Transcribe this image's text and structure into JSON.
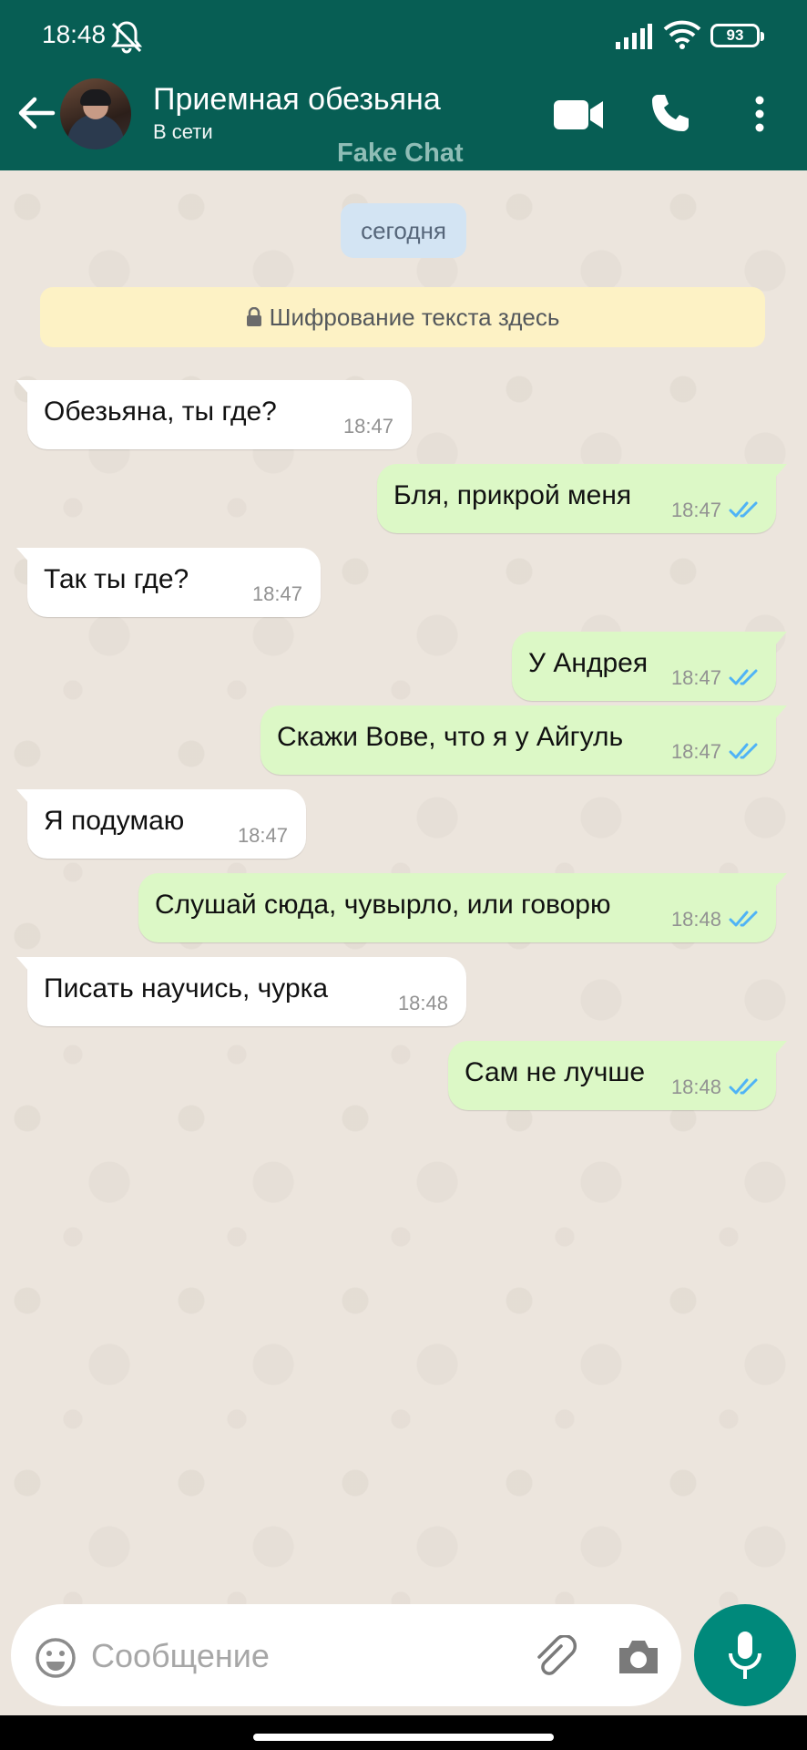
{
  "status_bar": {
    "time": "18:48",
    "battery": "93"
  },
  "header": {
    "contact_name": "Приемная обезьяна",
    "contact_status": "В сети",
    "watermark": "Fake Chat"
  },
  "chat": {
    "date_label": "сегодня",
    "encryption_notice": "Шифрование текста здесь",
    "messages": [
      {
        "direction": "in",
        "text": "Обезьяна, ты где?",
        "time": "18:47"
      },
      {
        "direction": "out",
        "text": "Бля, прикрой меня",
        "time": "18:47",
        "status": "read"
      },
      {
        "direction": "in",
        "text": "Так ты где?",
        "time": "18:47"
      },
      {
        "direction": "out",
        "text": "У Андрея",
        "time": "18:47",
        "status": "read"
      },
      {
        "direction": "out",
        "text": "Скажи Вове, что я у Айгуль",
        "time": "18:47",
        "status": "read"
      },
      {
        "direction": "in",
        "text": "Я подумаю",
        "time": "18:47"
      },
      {
        "direction": "out",
        "text": "Слушай сюда, чувырло, или говорю",
        "time": "18:48",
        "status": "read"
      },
      {
        "direction": "in",
        "text": "Писать научись, чурка",
        "time": "18:48"
      },
      {
        "direction": "out",
        "text": "Сам не лучше",
        "time": "18:48",
        "status": "read"
      }
    ]
  },
  "input": {
    "placeholder": "Сообщение"
  },
  "colors": {
    "header": "#075e54",
    "incoming_bubble": "#ffffff",
    "outgoing_bubble": "#dcf8c6",
    "read_ticks": "#4fb3f6",
    "mic_button": "#00897b"
  }
}
